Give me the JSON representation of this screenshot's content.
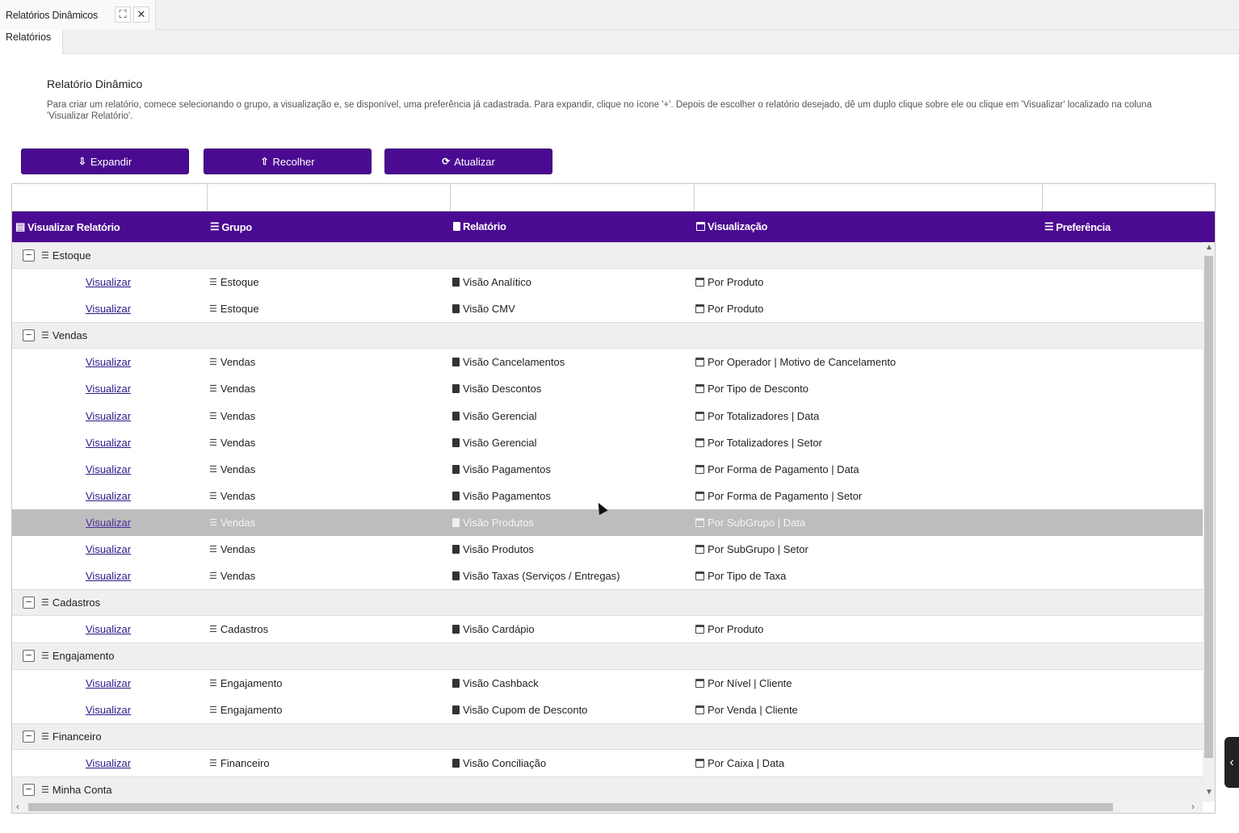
{
  "window_tab": {
    "title": "Relatórios Dinâmicos",
    "expand_glyph": "⛶",
    "close_glyph": "✕"
  },
  "sub_tab": {
    "label": "Relatórios"
  },
  "header": {
    "title": "Relatório Dinâmico",
    "description": "Para criar um relatório, comece selecionando o grupo, a visualização e, se disponível, uma preferência já cadastrada. Para expandir, clique no ícone '+'. Depois de escolher o relatório desejado, dê um duplo clique sobre ele ou clique em 'Visualizar' localizado na coluna 'Visualizar Relatório'."
  },
  "toolbar": {
    "expand_label": "Expandir",
    "expand_icon": "⇩",
    "collapse_label": "Recolher",
    "collapse_icon": "⇧",
    "refresh_label": "Atualizar",
    "refresh_icon": "⟳"
  },
  "columns": {
    "view": "Visualizar Relatório",
    "group": "Grupo",
    "report": "Relatório",
    "visualization": "Visualização",
    "preference": "Preferência"
  },
  "link_label": "Visualizar",
  "groups": [
    {
      "name": "Estoque",
      "rows": [
        {
          "group": "Estoque",
          "report": "Visão Analítico",
          "visualization": "Por Produto"
        },
        {
          "group": "Estoque",
          "report": "Visão CMV",
          "visualization": "Por Produto"
        }
      ]
    },
    {
      "name": "Vendas",
      "rows": [
        {
          "group": "Vendas",
          "report": "Visão Cancelamentos",
          "visualization": "Por Operador | Motivo de Cancelamento"
        },
        {
          "group": "Vendas",
          "report": "Visão Descontos",
          "visualization": "Por Tipo de Desconto"
        },
        {
          "group": "Vendas",
          "report": "Visão Gerencial",
          "visualization": "Por Totalizadores | Data"
        },
        {
          "group": "Vendas",
          "report": "Visão Gerencial",
          "visualization": "Por Totalizadores | Setor"
        },
        {
          "group": "Vendas",
          "report": "Visão Pagamentos",
          "visualization": "Por Forma de Pagamento | Data"
        },
        {
          "group": "Vendas",
          "report": "Visão Pagamentos",
          "visualization": "Por Forma de Pagamento | Setor"
        },
        {
          "group": "Vendas",
          "report": "Visão Produtos",
          "visualization": "Por SubGrupo | Data",
          "selected": true
        },
        {
          "group": "Vendas",
          "report": "Visão Produtos",
          "visualization": "Por SubGrupo | Setor"
        },
        {
          "group": "Vendas",
          "report": "Visão Taxas (Serviços / Entregas)",
          "visualization": "Por Tipo de Taxa"
        }
      ]
    },
    {
      "name": "Cadastros",
      "rows": [
        {
          "group": "Cadastros",
          "report": "Visão Cardápio",
          "visualization": "Por Produto"
        }
      ]
    },
    {
      "name": "Engajamento",
      "rows": [
        {
          "group": "Engajamento",
          "report": "Visão Cashback",
          "visualization": "Por Nível | Cliente"
        },
        {
          "group": "Engajamento",
          "report": "Visão Cupom de Desconto",
          "visualization": "Por Venda | Cliente"
        }
      ]
    },
    {
      "name": "Financeiro",
      "rows": [
        {
          "group": "Financeiro",
          "report": "Visão Conciliação",
          "visualization": "Por Caixa | Data"
        }
      ]
    },
    {
      "name": "Minha Conta",
      "rows": []
    }
  ],
  "icons": {
    "list": "☰",
    "chart": "📈",
    "toggle_minus": "−",
    "side_chevron": "‹",
    "scroll_up": "▲",
    "scroll_down": "▼",
    "scroll_left": "‹",
    "scroll_right": "›"
  },
  "colors": {
    "accent": "#4a0a91",
    "selected_row": "#bdbdbd",
    "group_row": "#efefef"
  }
}
